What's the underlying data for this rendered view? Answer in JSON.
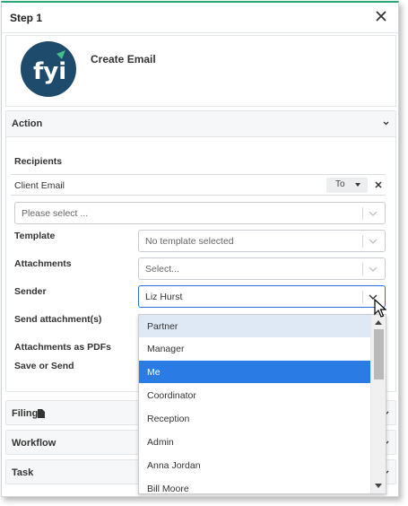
{
  "header": {
    "title": "Step 1"
  },
  "intro": {
    "title": "Create Email"
  },
  "action": {
    "label": "Action",
    "recipients_label": "Recipients",
    "recipient": {
      "name": "Client Email",
      "type": "To"
    },
    "recipient_select_placeholder": "Please select ...",
    "template": {
      "label": "Template",
      "value": "No template selected"
    },
    "attachments": {
      "label": "Attachments",
      "value": "Select..."
    },
    "sender": {
      "label": "Sender",
      "value": "Liz Hurst"
    },
    "send_attachments_label": "Send attachment(s)",
    "attachments_as_pdfs_label": "Attachments as PDFs",
    "save_or_send_label": "Save or Send"
  },
  "sender_options": [
    "Partner",
    "Manager",
    "Me",
    "Coordinator",
    "Reception",
    "Admin",
    "Anna Jordan",
    "Bill Moore"
  ],
  "sender_options_state": {
    "hovered": "Partner",
    "selected": "Me"
  },
  "sections": {
    "filing": "Filing",
    "workflow": "Workflow",
    "task": "Task"
  },
  "colors": {
    "accent": "#2aa876",
    "selected": "#2b7be4",
    "hover": "#dfe9f6",
    "logo_bg": "#1e4a6b",
    "focus_border": "#2b6cd8"
  }
}
